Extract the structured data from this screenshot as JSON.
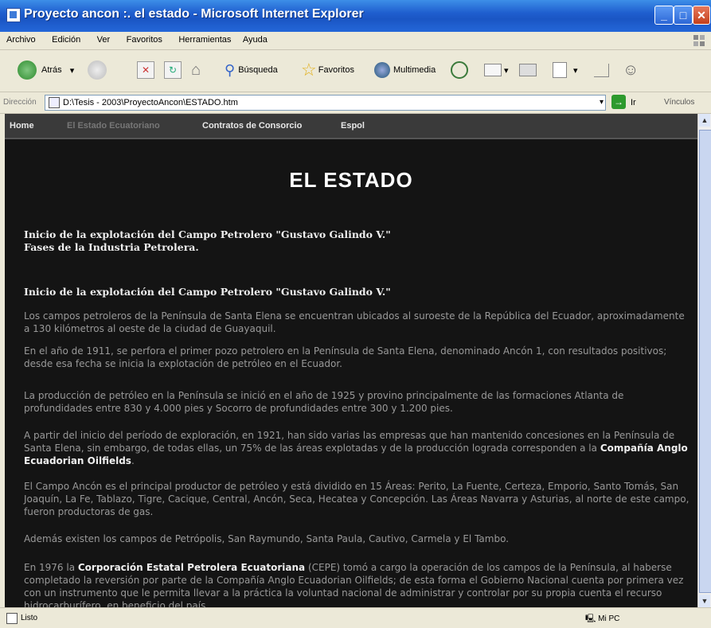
{
  "window": {
    "title": "Proyecto ancon :. el estado - Microsoft Internet Explorer",
    "minimize": "_",
    "maximize": "□",
    "close": "✕"
  },
  "menubar": {
    "items": [
      "Archivo",
      "Edición",
      "Ver",
      "Favoritos",
      "Herramientas",
      "Ayuda"
    ]
  },
  "toolbar": {
    "back_label": "Atrás",
    "search_label": "Búsqueda",
    "favorites_label": "Favoritos",
    "multimedia_label": "Multimedia"
  },
  "address": {
    "label": "Dirección",
    "value": "D:\\Tesis - 2003\\ProyectoAncon\\ESTADO.htm",
    "go_label": "Ir",
    "links_label": "Vínculos"
  },
  "nav": {
    "items": [
      "Home",
      "El Estado Ecuatoriano",
      "Contratos de Consorcio",
      "Espol"
    ]
  },
  "page": {
    "heading": "EL ESTADO",
    "toc_1": "Inicio de la explotación del Campo Petrolero \"Gustavo Galindo V.\"",
    "toc_2": "Fases de la Industria Petrolera.",
    "section_title": "Inicio de la explotación del Campo Petrolero \"Gustavo Galindo V.\"",
    "p1": "Los campos petroleros de la Península de Santa Elena se encuentran ubicados al suroeste de la República del Ecuador, aproximadamente a 130 kilómetros al oeste de la ciudad de Guayaquil.",
    "p2": "En el año de 1911, se perfora el primer pozo petrolero en la Península de Santa Elena, denominado Ancón 1, con resultados positivos; desde esa fecha se inicia la explotación de petróleo en el Ecuador.",
    "p3": "La producción de petróleo en la Península se inició en el año de 1925 y provino principalmente de las formaciones Atlanta de profundidades entre 830 y 4.000 pies y Socorro de profundidades entre 300 y 1.200 pies.",
    "p4_a": "A partir del inicio del período de exploración, en 1921, han sido varias las empresas que han mantenido concesiones en la Península de Santa Elena, sin embargo, de todas ellas, un 75% de las áreas explotadas y de la producción lograda corresponden a la ",
    "p4_b": "Compañía Anglo Ecuadorian Oilfields",
    "p4_c": ".",
    "p5": "El Campo Ancón es el principal productor de petróleo y está dividido en 15 Áreas: Perito, La Fuente, Certeza, Emporio, Santo Tomás, San Joaquín, La Fe, Tablazo, Tigre, Cacique, Central, Ancón, Seca, Hecatea y Concepción. Las Áreas Navarra y Asturias, al norte de este campo, fueron productoras de gas.",
    "p6": "Además existen los campos de Petrópolis, San Raymundo, Santa Paula, Cautivo, Carmela y El Tambo.",
    "p7_a": "En 1976 la ",
    "p7_b": "Corporación Estatal Petrolera Ecuatoriana",
    "p7_c": " (CEPE) tomó a cargo la operación de los campos de la Península, al haberse completado la reversión por parte de la Compañía Anglo Ecuadorian Oilfields; de esta forma el Gobierno Nacional cuenta por primera vez con un instrumento que le permita llevar a la práctica la voluntad nacional de administrar y controlar por su propia cuenta el recurso hidrocarburífero, en beneficio del país."
  },
  "status": {
    "text": "Listo",
    "zone": "Mi PC"
  }
}
